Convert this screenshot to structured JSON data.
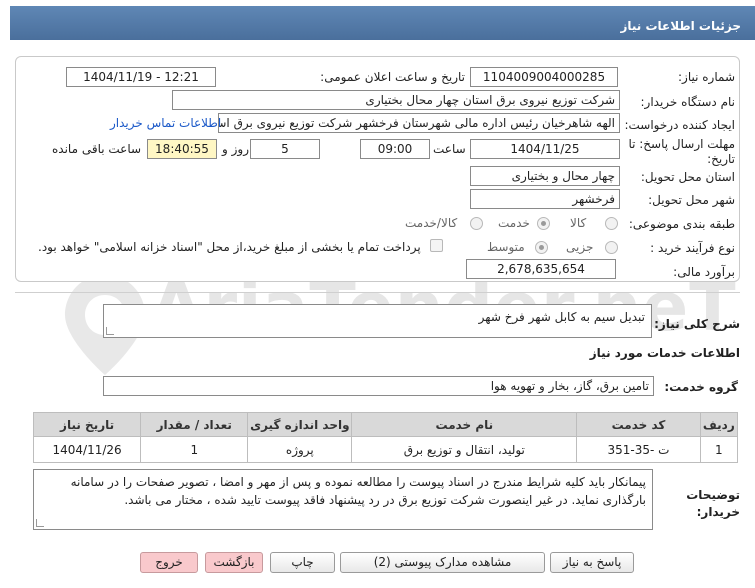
{
  "header": {
    "title": "جزئیات اطلاعات نیاز"
  },
  "form": {
    "need_number_label": "شماره نیاز:",
    "need_number": "1104009004000285",
    "announce_datetime_label": "تاریخ و ساعت اعلان عمومی:",
    "announce_datetime": "1404/11/19 - 12:21",
    "buyer_org_label": "نام دستگاه خریدار:",
    "buyer_org": "شرکت توزیع نیروی برق استان چهار محال بختیاری",
    "creator_label": "ایجاد کننده درخواست:",
    "creator": "الهه شاهرخیان رئیس اداره مالی شهرستان فرخشهر شرکت توزیع نیروی برق اس",
    "contact_link": "اطلاعات تماس خریدار",
    "deadline_label": "مهلت ارسال پاسخ: تا تاریخ:",
    "deadline_date": "1404/11/25",
    "time_label": "ساعت",
    "deadline_time": "09:00",
    "days_value": "5",
    "days_label": "روز و",
    "remaining_time": "18:40:55",
    "remaining_label": "ساعت باقی مانده",
    "province_label": "استان محل تحویل:",
    "province": "چهار محال و بختیاری",
    "city_label": "شهر محل تحویل:",
    "city": "فرخشهر",
    "category_label": "طبقه بندی موضوعی:",
    "category_options": [
      "کالا",
      "خدمت",
      "کالا/خدمت"
    ],
    "category_selected": "خدمت",
    "process_label": "نوع فرآیند خرید :",
    "process_options": [
      "جزیی",
      "متوسط"
    ],
    "process_selected": "متوسط",
    "payment_note": "پرداخت تمام یا بخشی از مبلغ خرید،از محل \"اسناد خزانه اسلامی\" خواهد بود.",
    "budget_label": "برآورد مالی:",
    "budget": "2,678,635,654"
  },
  "summary": {
    "label": "شرح کلی نیاز:",
    "value": "تبدیل سیم به کابل شهر فرخ شهر"
  },
  "services": {
    "section_title": "اطلاعات خدمات مورد نیاز",
    "group_label": "گروه خدمت:",
    "group_value": "تامین برق، گاز، بخار و تهویه هوا",
    "table_headers": [
      "ردیف",
      "کد خدمت",
      "نام خدمت",
      "واحد اندازه گیری",
      "تعداد / مقدار",
      "تاریخ نیاز"
    ],
    "rows": [
      {
        "row": "1",
        "code": "ت -35-351",
        "name": "تولید، انتقال و توزیع برق",
        "unit": "پروژه",
        "qty": "1",
        "date": "1404/11/26"
      }
    ]
  },
  "buyer_notes": {
    "label": "توضیحات خریدار:",
    "text": "پیمانکار باید کلیه شرایط مندرج در اسناد پیوست را مطالعه نموده و پس از مهر و امضا ، تصویر صفحات را در سامانه بارگذاری نماید. در غیر اینصورت شرکت توزیع برق در رد پیشنهاد فاقد پیوست تایید شده ، مختار می باشد."
  },
  "buttons": {
    "reply": "پاسخ به نیاز",
    "attachments": "مشاهده مدارک پیوستی (2)",
    "print": "چاپ",
    "back": "بازگشت",
    "exit": "خروج"
  },
  "watermark": {
    "text": "AriaTender.neT"
  },
  "colors": {
    "header": "#4f76a5",
    "link": "#1a58c8",
    "remaining_bg": "#fff7c4",
    "pink_button": "#f9c9cc"
  }
}
